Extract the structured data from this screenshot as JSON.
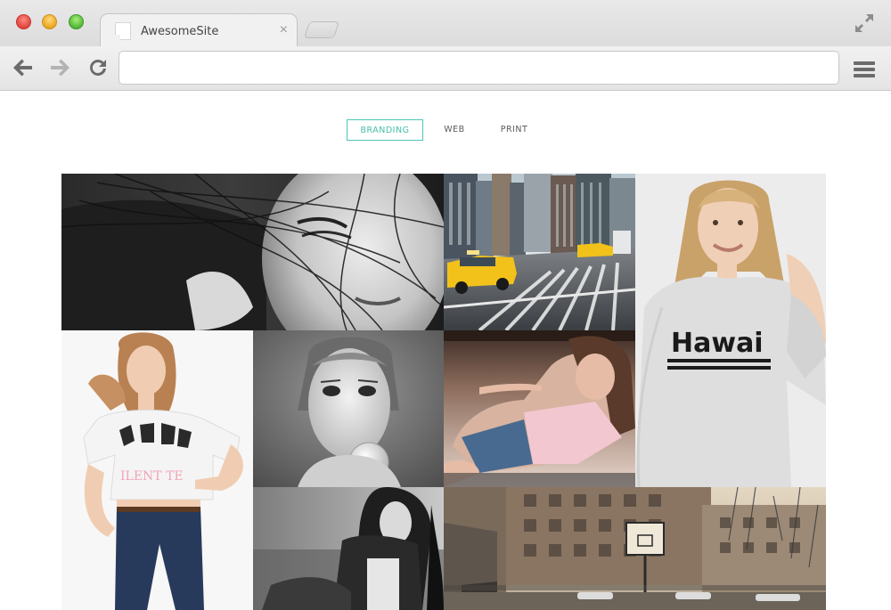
{
  "browser": {
    "tab_title": "AwesomeSite",
    "tab_close": "×",
    "address_value": ""
  },
  "filters": [
    {
      "label": "BRANDING",
      "active": true
    },
    {
      "label": "WEB",
      "active": false
    },
    {
      "label": "PRINT",
      "active": false
    }
  ],
  "gallery": {
    "tiles": [
      {
        "name": "bw-portrait-closeup",
        "subject": "black and white close-up of woman with hair across face"
      },
      {
        "name": "city-street-taxi",
        "subject": "city street with yellow taxi and crosswalk"
      },
      {
        "name": "hawaii-shirt-model",
        "subject": "blonde model in grey sweatshirt printed Hawaii"
      },
      {
        "name": "tshirt-jeans-model",
        "subject": "model in white graphic t-shirt and jeans"
      },
      {
        "name": "bubblegum-portrait",
        "subject": "black and white portrait blowing bubble gum"
      },
      {
        "name": "reclining-model",
        "subject": "woman reclining in pink top and denim shorts"
      },
      {
        "name": "leather-jacket-model",
        "subject": "black and white model in leather jacket"
      },
      {
        "name": "basketball-court",
        "subject": "urban basketball court with buildings"
      }
    ],
    "print_text": "Hawai"
  },
  "colors": {
    "accent": "#4cc5b5",
    "taxi": "#f2c21b"
  }
}
